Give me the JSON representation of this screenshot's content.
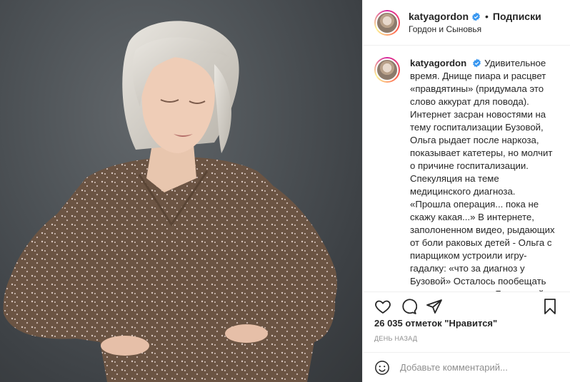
{
  "header": {
    "username": "katyagordon",
    "separator": "•",
    "follow_label": "Подписки",
    "location": "Гордон и Сыновья"
  },
  "caption": {
    "username": "katyagordon",
    "text": "Удивительное время. Днище пиара и расцвет «правдятины» (придумала это слово аккурат для повода). Интернет засран новостями на тему госпитализации Бузовой, Ольга рыдает после наркоза, показывает катетеры, но молчит о причине госпитализации. Спекуляция на теме медицинского диагноза. «Прошла операция... пока не скажу какая...» В интернете, заполоненном видео, рыдающих от боли раковых детей - Ольга с пиарщиком устроили игру-гадалку: «что за диагноз у Бузовой» Осталось пообещать приз отгадавшему. Я, пожалуй, его поставлю. Оля заигралась. Оля не чует границ искренности и дешевой игры."
  },
  "actions": {
    "icons": [
      "heart-icon",
      "comment-icon",
      "share-icon",
      "bookmark-icon"
    ]
  },
  "likes": "26 035 отметок \"Нравится\"",
  "timestamp": "ДЕНЬ НАЗАД",
  "comment_box": {
    "placeholder": "Добавьте комментарий..."
  },
  "colors": {
    "verified": "#3897f0",
    "text": "#262626",
    "muted": "#8e8e8e",
    "border": "#efefef"
  }
}
